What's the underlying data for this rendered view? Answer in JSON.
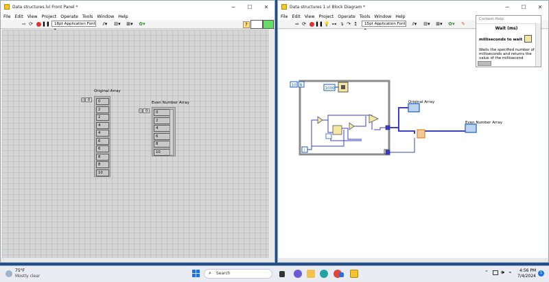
{
  "front_panel": {
    "title": "Data structures.lvi Front Panel *",
    "menu": [
      "File",
      "Edit",
      "View",
      "Project",
      "Operate",
      "Tools",
      "Window",
      "Help"
    ],
    "font_select": "18pt Application Font",
    "original_array": {
      "label": "Original Array",
      "index": "0",
      "values": [
        "0",
        "2",
        "2",
        "4",
        "4",
        "6",
        "6",
        "8",
        "8",
        "10"
      ]
    },
    "even_array": {
      "label": "Even Number Array",
      "index": "0",
      "values": [
        "0",
        "2",
        "4",
        "6",
        "8",
        "10"
      ]
    }
  },
  "block_diagram": {
    "title": "Data structures 1.vi Block Diagram *",
    "menu": [
      "File",
      "Edit",
      "View",
      "Project",
      "Operate",
      "Tools",
      "Window",
      "Help"
    ],
    "font_select": "15pt Application Font",
    "loop_count": "10",
    "loop_count_terminal": "N",
    "wait_constant": "1000",
    "iteration_terminal": "i",
    "original_array_label": "Original Array",
    "even_array_label": "Even Number Array"
  },
  "context_help": {
    "title": "Context Help",
    "function_name": "Wait (ms)",
    "input_label": "milliseconds to wait",
    "description": "Waits the specified number of milliseconds and returns the value of the millisecond"
  },
  "taskbar": {
    "temperature": "75°F",
    "weather": "Mostly clear",
    "search_placeholder": "Search",
    "time": "4:56 PM",
    "date": "7/4/2024",
    "notification_count": "1"
  },
  "colors": {
    "wire_blue": "#3a3fc4",
    "int_blue": "#1a5fb4",
    "node_yellow": "#f4e7a1",
    "wire_orange": "#d27a10"
  }
}
